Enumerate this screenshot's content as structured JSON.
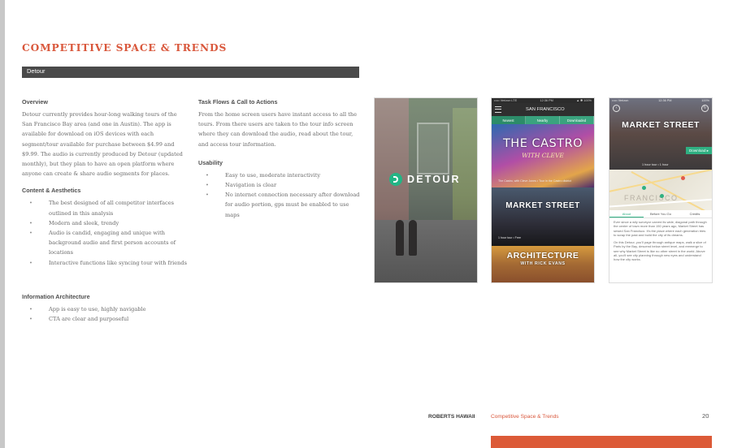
{
  "header": {
    "title": "COMPETITIVE SPACE & TRENDS",
    "section_bar_label": "Detour"
  },
  "left_column": {
    "overview_heading": "Overview",
    "overview_text": "Detour currently provides hour-long walking tours of the San Francisco Bay area (and one in Austin). The app is available for download on iOS devices with each segment/tour available for purchase between $4.99 and $9.99. The audio is currently produced by Detour (updated monthly), but they plan to have an open platform where anyone can create & share audio segments for places.",
    "content_heading": "Content & Aesthetics",
    "content_items": [
      "The best designed of all competitor interfaces outlined in this analysis",
      "Modern and sleek, trendy",
      "Audio is candid, engaging and unique with background audio and first person accounts of locations",
      "Interactive functions like syncing tour with friends"
    ],
    "ia_heading": "Information Architecture",
    "ia_items": [
      "App is easy to use, highly navigable",
      "CTA are clear and purposeful"
    ]
  },
  "right_column": {
    "taskflows_heading": "Task Flows & Call to Actions",
    "taskflows_text": "From the home screen users have instant access to all the tours. From there users are taken to the tour info screen where they can download the audio, read about the tour, and access tour information.",
    "usability_heading": "Usability",
    "usability_items": [
      "Easy to use, moderate interactivity",
      "Navigation is clear",
      "No internet connection necessary after download for audio portion, gps must be enabled to use maps"
    ]
  },
  "screens": {
    "screen1": {
      "logo_text": "DETOUR"
    },
    "screen2": {
      "status_left": "••••• Verizon LTE",
      "status_center": "12:36 PM",
      "status_right": "▲ ✱ 100%",
      "city": "SAN FRANCISCO",
      "tabs": [
        "Newest",
        "Nearby",
        "Downloaded"
      ],
      "card1_title": "THE CASTRO",
      "card1_subtitle": "WITH CLEVE",
      "card1_meta": "The Castro, with Cleve Jones • Tour in the Castro district",
      "card2_title": "MARKET STREET",
      "card2_meta": "1 hour tour • Free",
      "card3_title": "ARCHITECTURE",
      "card3_subtitle": "WITH RICK EVANS"
    },
    "screen3": {
      "status_left": "••••• Verizon",
      "status_center": "12:36 PM",
      "status_right": "100%",
      "title": "MARKET STREET",
      "download_label": "Download ▸",
      "hero_meta": "1 hour tour • 1 hour",
      "map_label": "FRANCISCO",
      "subtabs": [
        "About",
        "Before You Go",
        "Credits"
      ],
      "body_p1": "Ever since a wily surveyor carved its wide, diagonal path through the center of town more than 150 years ago, Market Street has sewed San Francisco. It's the place where each generation tries to scrap the past and build the city of its dreams.",
      "body_p2": "On this Detour, you'll page through antique maps, walk a slice of Paris by the Bay, descend below street level, and reemerge to see why Market Street is like no other street in the world. Above all, you'll see city planning through new eyes and understand how the city works."
    }
  },
  "footer": {
    "org": "ROBERTS HAWAII",
    "section": "Competitive Space  & Trends",
    "page_number": "20"
  },
  "colors": {
    "accent": "#d9573b",
    "bar": "#4a4a4a",
    "detour_green": "#22b585"
  }
}
